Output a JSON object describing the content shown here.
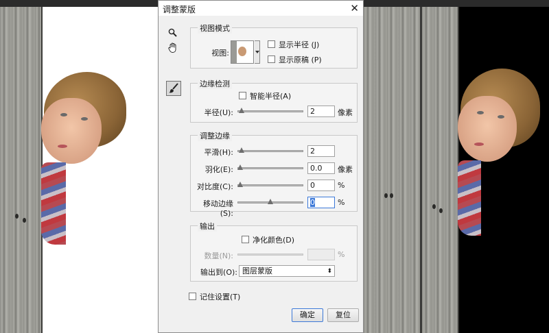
{
  "dialog": {
    "title": "调整蒙版",
    "close_glyph": "✕"
  },
  "tools": {
    "zoom": "zoom-tool-icon",
    "hand": "hand-tool-icon",
    "refine_brush": "refine-radius-brush-icon"
  },
  "view_mode": {
    "legend": "视图模式",
    "view_label": "视图:",
    "show_radius_label": "显示半径 (J)",
    "show_radius_checked": false,
    "show_original_label": "显示原稿 (P)",
    "show_original_checked": false
  },
  "edge_detection": {
    "legend": "边缘检测",
    "smart_radius_label": "智能半径(A)",
    "smart_radius_checked": false,
    "radius_label": "半径(U):",
    "radius_value": "2",
    "radius_slider_fraction": 0.02,
    "radius_unit": "像素"
  },
  "adjust_edge": {
    "legend": "调整边缘",
    "smooth_label": "平滑(H):",
    "smooth_value": "2",
    "smooth_slider_fraction": 0.02,
    "feather_label": "羽化(E):",
    "feather_value": "0.0",
    "feather_slider_fraction": 0.0,
    "feather_unit": "像素",
    "contrast_label": "对比度(C):",
    "contrast_value": "0",
    "contrast_slider_fraction": 0.0,
    "contrast_unit": "%",
    "shift_label": "移动边缘(S):",
    "shift_value": "0",
    "shift_slider_fraction": 0.5,
    "shift_unit": "%"
  },
  "output": {
    "legend": "输出",
    "decontaminate_label": "净化颜色(D)",
    "decontaminate_checked": false,
    "amount_label": "数量(N):",
    "amount_unit": "%",
    "output_to_label": "输出到(O):",
    "output_to_value": "图层蒙版",
    "output_to_arrow": "⬍"
  },
  "remember_label": "记住设置(T)",
  "remember_checked": false,
  "ok_label": "确定",
  "reset_label": "复位",
  "colors": {
    "dialog_bg": "#f0f0f0",
    "accent": "#3b78d8",
    "left_preview_bg": "#ffffff",
    "right_preview_bg": "#000000"
  }
}
